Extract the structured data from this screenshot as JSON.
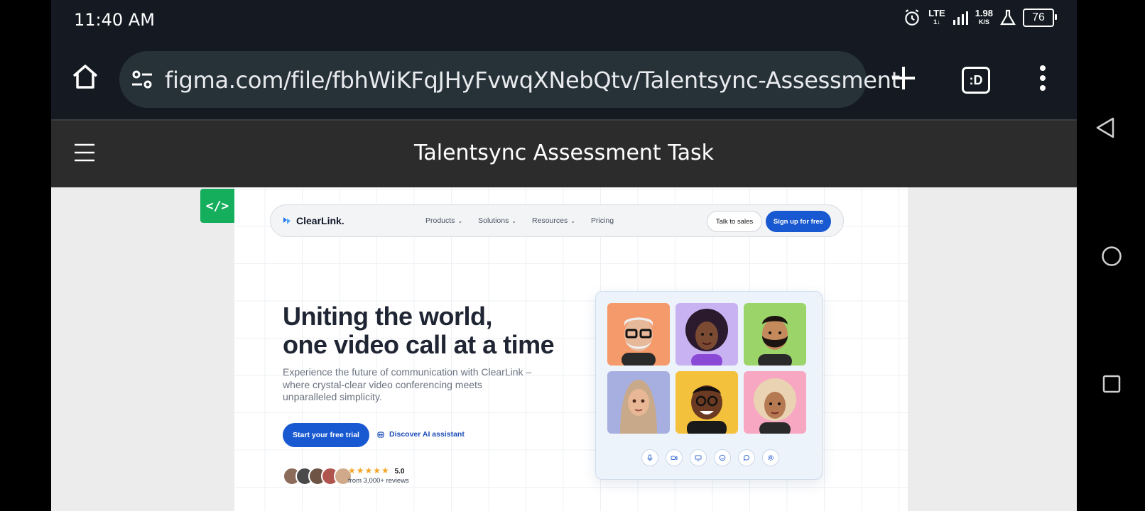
{
  "status_bar": {
    "time": "11:40 AM",
    "network_top": "LTE",
    "network_sub": "1↓",
    "speed_value": "1.98",
    "speed_unit": "K/S",
    "battery": "76"
  },
  "browser": {
    "url": "figma.com/file/fbhWiKFqJHyFvwqXNebQtv/Talentsync-Assessment",
    "tabs_label": ":D"
  },
  "figma": {
    "file_title": "Talentsync Assessment Task",
    "dev_mode_label": "</>"
  },
  "site": {
    "brand": "ClearLink.",
    "menu": [
      {
        "label": "Products",
        "dropdown": true
      },
      {
        "label": "Solutions",
        "dropdown": true
      },
      {
        "label": "Resources",
        "dropdown": true
      },
      {
        "label": "Pricing",
        "dropdown": false
      }
    ],
    "talk_to_sales": "Talk to sales",
    "sign_up": "Sign up for free",
    "hero_title_line1": "Uniting the world,",
    "hero_title_line2": "one video call at a time",
    "hero_subtitle": "Experience the future of communication with ClearLink – where crystal-clear video conferencing meets unparalleled simplicity.",
    "cta_primary": "Start your free trial",
    "cta_secondary": "Discover AI assistant",
    "rating_value": "5.0",
    "reviews_text": "from 3,000+ reviews",
    "stars": "★★★★★"
  },
  "colors": {
    "accent": "#1859d1",
    "star": "#f5a623",
    "figma_green": "#14ae5c"
  }
}
